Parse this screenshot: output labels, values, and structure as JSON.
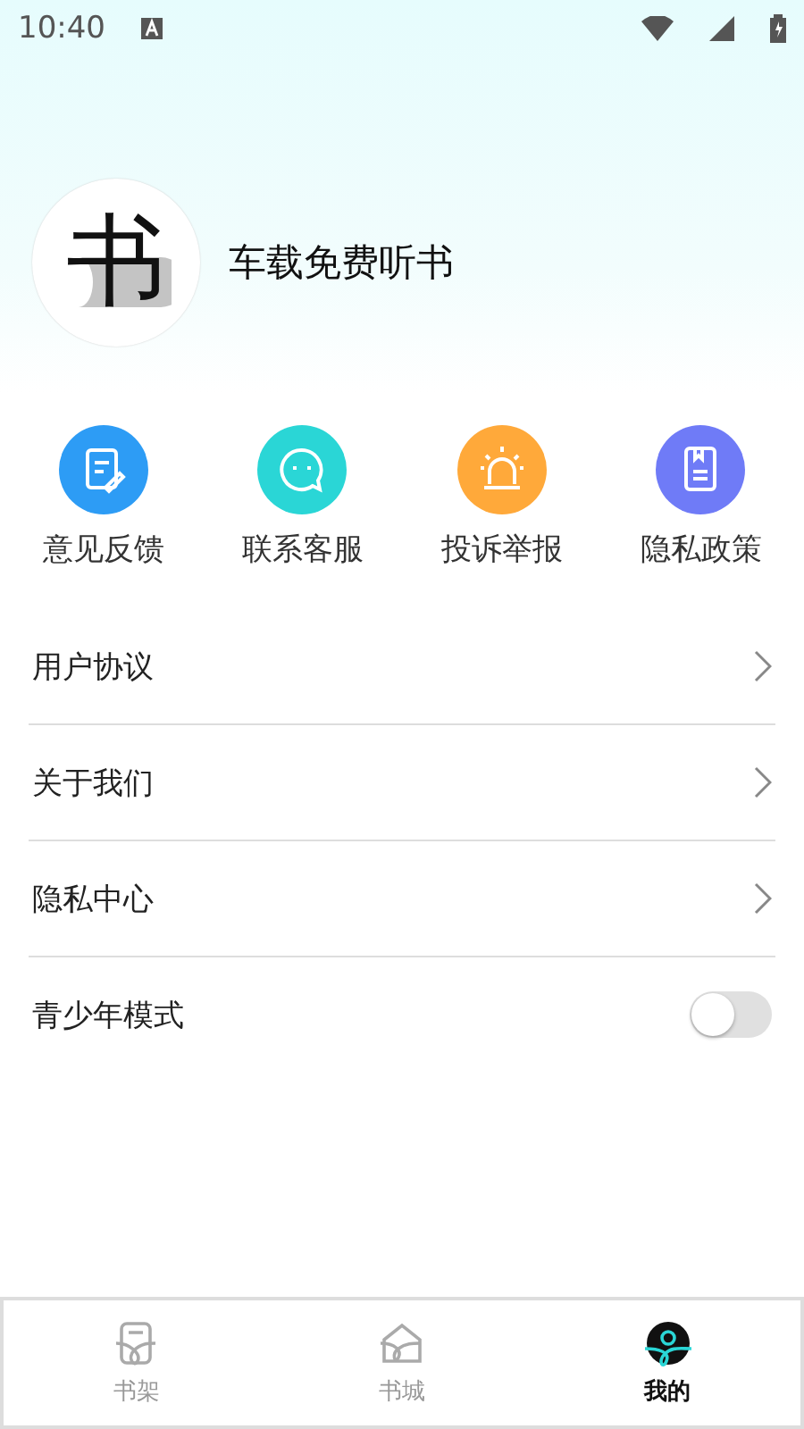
{
  "status_bar": {
    "time": "10:40"
  },
  "profile": {
    "logo_text": "书",
    "name": "车载免费听书"
  },
  "quick_actions": [
    {
      "label": "意见反馈",
      "kind": "feedback",
      "color": "#2d9cf5"
    },
    {
      "label": "联系客服",
      "kind": "chat",
      "color": "#2ad6d6"
    },
    {
      "label": "投诉举报",
      "kind": "alarm",
      "color": "#ffa93a"
    },
    {
      "label": "隐私政策",
      "kind": "policy",
      "color": "#6f7bf7"
    }
  ],
  "menu": [
    {
      "label": "用户协议",
      "kind": "link"
    },
    {
      "label": "关于我们",
      "kind": "link"
    },
    {
      "label": "隐私中心",
      "kind": "link"
    },
    {
      "label": "青少年模式",
      "kind": "toggle",
      "on": false
    }
  ],
  "tabs": [
    {
      "label": "书架",
      "kind": "shelf",
      "selected": false
    },
    {
      "label": "书城",
      "kind": "store",
      "selected": false
    },
    {
      "label": "我的",
      "kind": "me",
      "selected": true
    }
  ]
}
